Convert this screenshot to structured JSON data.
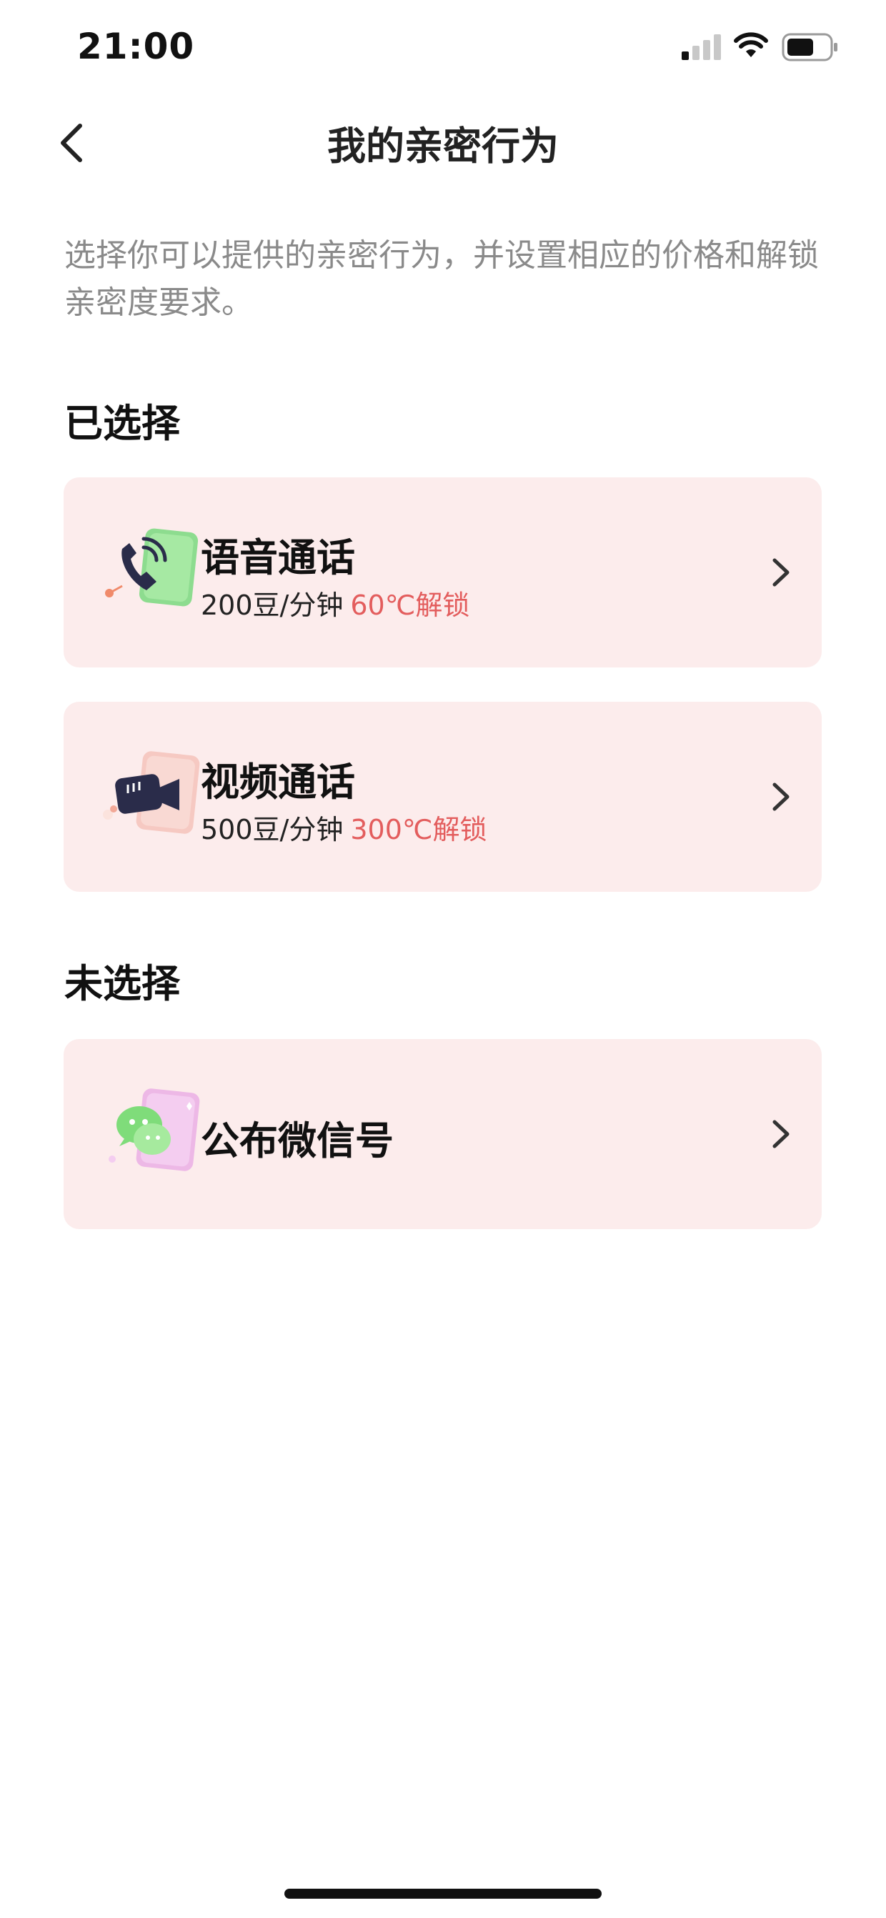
{
  "status_bar": {
    "time": "21:00"
  },
  "nav": {
    "title": "我的亲密行为"
  },
  "intro": "选择你可以提供的亲密行为，并设置相应的价格和解锁亲密度要求。",
  "selected": {
    "title": "已选择",
    "items": [
      {
        "name": "语音通话",
        "price": "200豆/分钟",
        "unlock": "60℃解锁",
        "icon": "phone-call-icon"
      },
      {
        "name": "视频通话",
        "price": "500豆/分钟",
        "unlock": "300℃解锁",
        "icon": "video-camera-icon"
      }
    ]
  },
  "unselected": {
    "title": "未选择",
    "items": [
      {
        "name": "公布微信号",
        "icon": "wechat-icon"
      }
    ]
  },
  "colors": {
    "card_bg": "#fcecec",
    "unlock_text": "#e35d5d",
    "intro_text": "#8a8a8a"
  }
}
